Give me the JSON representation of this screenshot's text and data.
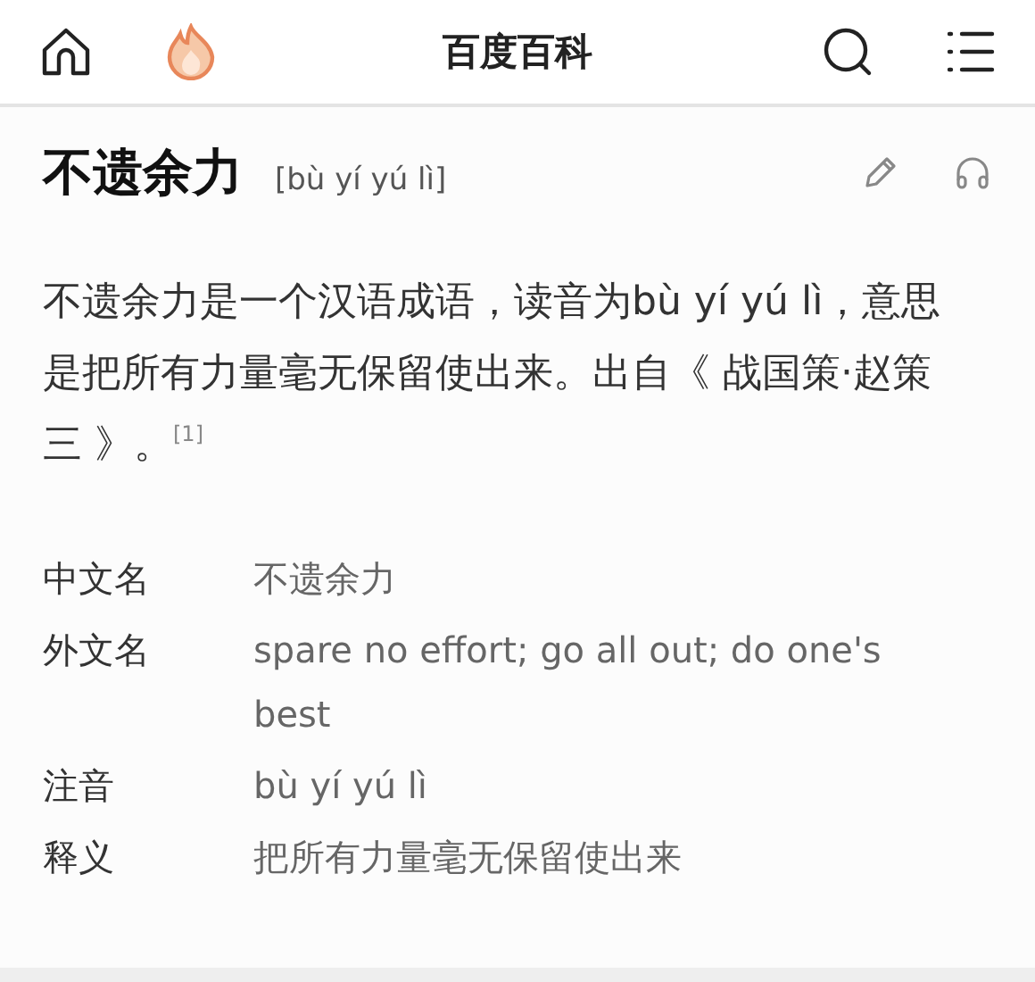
{
  "header": {
    "title": "百度百科"
  },
  "entry": {
    "title": "不遗余力",
    "pinyin": "[bù yí yú lì]"
  },
  "summary": "不遗余力是一个汉语成语，读音为bù yí yú lì，意思是把所有力量毫无保留使出来。出自《 战国策·赵策三 》。$^{[1]}$",
  "info": [
    {
      "label": "中文名",
      "value": "不遗余力"
    },
    {
      "label": "外文名",
      "value": "spare no effort; go all out; do one's best"
    },
    {
      "label": "注音",
      "value": "bù yí yú lì"
    },
    {
      "label": "释义",
      "value": "把所有力量毫无保留使出来"
    }
  ]
}
